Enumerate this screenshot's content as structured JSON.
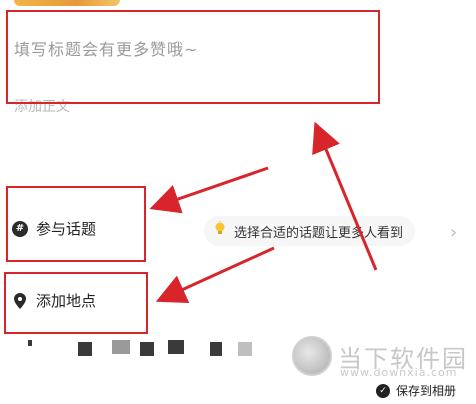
{
  "editor": {
    "title_placeholder": "填写标题会有更多赞哦~",
    "body_placeholder": "添加正文"
  },
  "options": {
    "topic_label": "参与话题",
    "location_label": "添加地点",
    "topic_suggestion": "选择合适的话题让更多人看到",
    "suggestion_icon": "lightbulb-icon"
  },
  "footer": {
    "save_to_album_label": "保存到相册"
  },
  "watermark": {
    "name": "当下软件园",
    "url": "www.downxia.com"
  },
  "annotation_color": "#d8242b"
}
